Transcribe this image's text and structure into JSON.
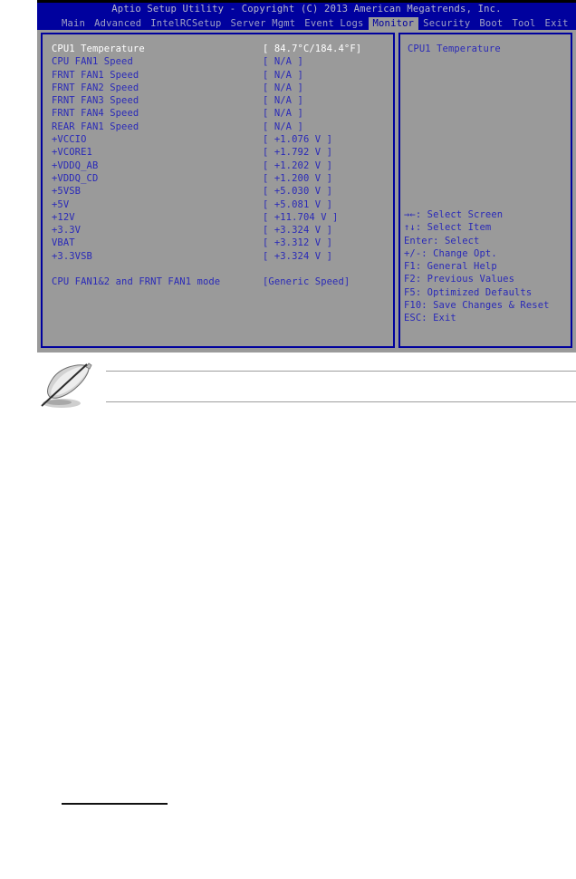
{
  "bios": {
    "title": "Aptio Setup Utility - Copyright (C) 2013 American Megatrends, Inc.",
    "menu": [
      {
        "label": "Main",
        "active": false
      },
      {
        "label": "Advanced",
        "active": false
      },
      {
        "label": "IntelRCSetup",
        "active": false
      },
      {
        "label": "Server Mgmt",
        "active": false
      },
      {
        "label": "Event Logs",
        "active": false
      },
      {
        "label": "Monitor",
        "active": true
      },
      {
        "label": "Security",
        "active": false
      },
      {
        "label": "Boot",
        "active": false
      },
      {
        "label": "Tool",
        "active": false
      },
      {
        "label": "Exit",
        "active": false
      }
    ],
    "rows": [
      {
        "label": "CPU1 Temperature",
        "value": "[ 84.7°C/184.4°F]",
        "selected": true
      },
      {
        "label": "CPU FAN1 Speed",
        "value": "[ N/A ]",
        "selected": false
      },
      {
        "label": "FRNT FAN1 Speed",
        "value": "[ N/A ]",
        "selected": false
      },
      {
        "label": "FRNT FAN2 Speed",
        "value": "[ N/A ]",
        "selected": false
      },
      {
        "label": "FRNT FAN3 Speed",
        "value": "[ N/A ]",
        "selected": false
      },
      {
        "label": "FRNT FAN4 Speed",
        "value": "[ N/A ]",
        "selected": false
      },
      {
        "label": "REAR FAN1 Speed",
        "value": "[ N/A ]",
        "selected": false
      },
      {
        "label": "+VCCIO",
        "value": "[ +1.076 V ]",
        "selected": false
      },
      {
        "label": "+VCORE1",
        "value": "[ +1.792 V ]",
        "selected": false
      },
      {
        "label": "+VDDQ_AB",
        "value": "[ +1.202 V ]",
        "selected": false
      },
      {
        "label": "+VDDQ_CD",
        "value": "[ +1.200 V ]",
        "selected": false
      },
      {
        "label": "+5VSB",
        "value": "[ +5.030 V ]",
        "selected": false
      },
      {
        "label": "+5V",
        "value": "[ +5.081 V ]",
        "selected": false
      },
      {
        "label": "+12V",
        "value": "[ +11.704 V ]",
        "selected": false
      },
      {
        "label": "+3.3V",
        "value": "[ +3.324 V ]",
        "selected": false
      },
      {
        "label": "VBAT",
        "value": "[ +3.312 V ]",
        "selected": false
      },
      {
        "label": "+3.3VSB",
        "value": "[ +3.324 V ]",
        "selected": false
      },
      {
        "label": "",
        "value": "",
        "selected": false
      },
      {
        "label": "CPU FAN1&2 and FRNT FAN1 mode",
        "value": "[Generic Speed]",
        "selected": false
      }
    ],
    "help": {
      "title": "CPU1 Temperature",
      "keys": [
        "→←: Select Screen",
        "↑↓: Select Item",
        "Enter: Select",
        "+/-: Change Opt.",
        "F1: General Help",
        "F2: Previous Values",
        "F5: Optimized Defaults",
        "F10: Save Changes & Reset",
        "ESC: Exit"
      ]
    },
    "colors": {
      "header_blue": "#00019e",
      "panel_gray": "#9a9a9a",
      "text_blue": "#2a2ab8",
      "text_selected": "#ffffff",
      "menu_text": "#9fa0c4"
    }
  },
  "note": {
    "icon": "note-quill-icon",
    "text": ""
  }
}
